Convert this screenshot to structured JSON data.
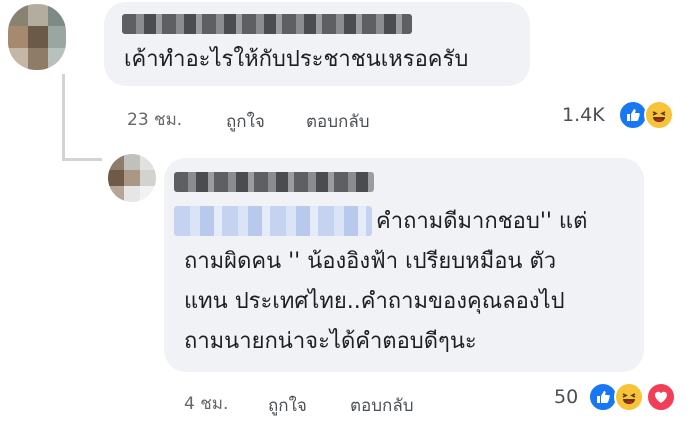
{
  "comment_main": {
    "author_name": "",
    "text": "เค้าทำอะไรให้กับประชาชนเหรอครับ",
    "timestamp": "23 ชม.",
    "like_action": "ถูกใจ",
    "reply_action": "ตอบกลับ",
    "reaction_count": "1.4K",
    "reactions": [
      "like-icon",
      "haha-icon"
    ]
  },
  "comment_reply": {
    "author_name": "",
    "text_lines": [
      "คำถามดีมากชอบ'' แต่",
      "ถามผิดคน '' น้องอิงฟ้า เปรียบหมือน ตัว",
      "แทน ประเทศไทย..คำถามของคุณลองไป",
      "ถามนายกน่าจะได้คำตอบดีๆนะ"
    ],
    "timestamp": "4 ชม.",
    "like_action": "ถูกใจ",
    "reply_action": "ตอบกลับ",
    "reaction_count": "50",
    "reactions": [
      "like-icon",
      "haha-icon",
      "love-icon"
    ]
  },
  "colors": {
    "bubble": "#f0f2f5",
    "like": "#1877f2",
    "haha": "#f7c33b",
    "love": "#f33e58",
    "meta": "#65676b"
  }
}
